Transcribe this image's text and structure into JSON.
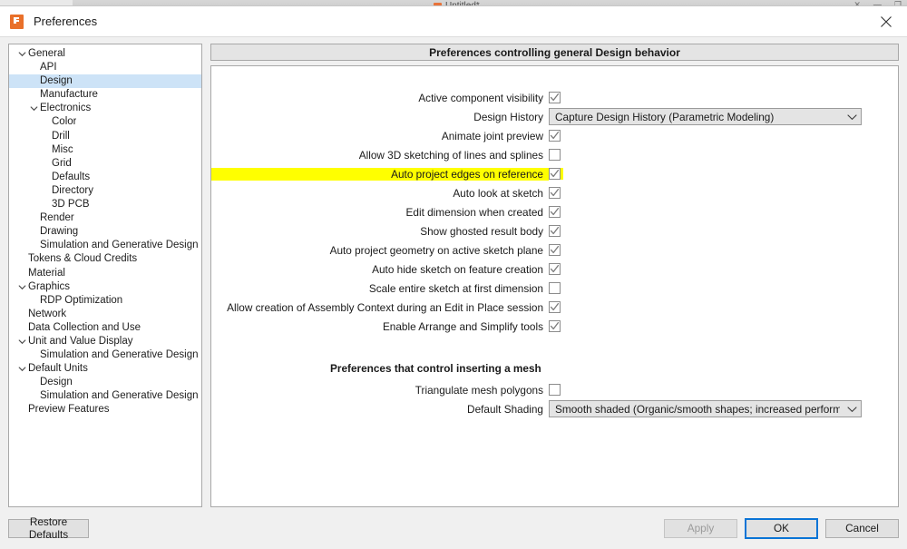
{
  "background_window": {
    "title": "Untitled*",
    "left_hint": "",
    "controls": [
      "✕",
      "▬",
      "❐"
    ]
  },
  "dialog": {
    "title": "Preferences",
    "app_icon": "fusion-logo-icon",
    "close_icon": "close-icon"
  },
  "tree": {
    "items": [
      {
        "label": "General",
        "level": 0,
        "chevron": "down",
        "selected": false
      },
      {
        "label": "API",
        "level": 1,
        "chevron": "",
        "selected": false
      },
      {
        "label": "Design",
        "level": 1,
        "chevron": "",
        "selected": true
      },
      {
        "label": "Manufacture",
        "level": 1,
        "chevron": "",
        "selected": false
      },
      {
        "label": "Electronics",
        "level": 1,
        "chevron": "down",
        "selected": false
      },
      {
        "label": "Color",
        "level": 2,
        "chevron": "",
        "selected": false
      },
      {
        "label": "Drill",
        "level": 2,
        "chevron": "",
        "selected": false
      },
      {
        "label": "Misc",
        "level": 2,
        "chevron": "",
        "selected": false
      },
      {
        "label": "Grid",
        "level": 2,
        "chevron": "",
        "selected": false
      },
      {
        "label": "Defaults",
        "level": 2,
        "chevron": "",
        "selected": false
      },
      {
        "label": "Directory",
        "level": 2,
        "chevron": "",
        "selected": false
      },
      {
        "label": "3D PCB",
        "level": 2,
        "chevron": "",
        "selected": false
      },
      {
        "label": "Render",
        "level": 1,
        "chevron": "",
        "selected": false
      },
      {
        "label": "Drawing",
        "level": 1,
        "chevron": "",
        "selected": false
      },
      {
        "label": "Simulation and Generative Design",
        "level": 1,
        "chevron": "",
        "selected": false
      },
      {
        "label": "Tokens & Cloud Credits",
        "level": 0,
        "chevron": "",
        "selected": false
      },
      {
        "label": "Material",
        "level": 0,
        "chevron": "",
        "selected": false
      },
      {
        "label": "Graphics",
        "level": 0,
        "chevron": "down",
        "selected": false
      },
      {
        "label": "RDP Optimization",
        "level": 1,
        "chevron": "",
        "selected": false
      },
      {
        "label": "Network",
        "level": 0,
        "chevron": "",
        "selected": false
      },
      {
        "label": "Data Collection and Use",
        "level": 0,
        "chevron": "",
        "selected": false
      },
      {
        "label": "Unit and Value Display",
        "level": 0,
        "chevron": "down",
        "selected": false
      },
      {
        "label": "Simulation and Generative Design",
        "level": 1,
        "chevron": "",
        "selected": false
      },
      {
        "label": "Default Units",
        "level": 0,
        "chevron": "down",
        "selected": false
      },
      {
        "label": "Design",
        "level": 1,
        "chevron": "",
        "selected": false
      },
      {
        "label": "Simulation and Generative Design",
        "level": 1,
        "chevron": "",
        "selected": false
      },
      {
        "label": "Preview Features",
        "level": 0,
        "chevron": "",
        "selected": false
      }
    ]
  },
  "panel": {
    "header": "Preferences controlling general Design behavior",
    "rows": [
      {
        "type": "checkbox",
        "label": "Active component visibility",
        "checked": true,
        "highlighted": false
      },
      {
        "type": "combo",
        "label": "Design History",
        "value": "Capture Design History (Parametric Modeling)",
        "highlighted": false
      },
      {
        "type": "checkbox",
        "label": "Animate joint preview",
        "checked": true,
        "highlighted": false
      },
      {
        "type": "checkbox",
        "label": "Allow 3D sketching of lines and splines",
        "checked": false,
        "highlighted": false
      },
      {
        "type": "checkbox",
        "label": "Auto project edges on reference",
        "checked": true,
        "highlighted": true
      },
      {
        "type": "checkbox",
        "label": "Auto look at sketch",
        "checked": true,
        "highlighted": false
      },
      {
        "type": "checkbox",
        "label": "Edit dimension when created",
        "checked": true,
        "highlighted": false
      },
      {
        "type": "checkbox",
        "label": "Show ghosted result body",
        "checked": true,
        "highlighted": false
      },
      {
        "type": "checkbox",
        "label": "Auto project geometry on active sketch plane",
        "checked": true,
        "highlighted": false
      },
      {
        "type": "checkbox",
        "label": "Auto hide sketch on feature creation",
        "checked": true,
        "highlighted": false
      },
      {
        "type": "checkbox",
        "label": "Scale entire sketch at first dimension",
        "checked": false,
        "highlighted": false
      },
      {
        "type": "checkbox",
        "label": "Allow creation of Assembly Context during an Edit in Place session",
        "checked": true,
        "highlighted": false
      },
      {
        "type": "checkbox",
        "label": "Enable Arrange and Simplify tools",
        "checked": true,
        "highlighted": false
      }
    ],
    "mesh_section": {
      "title": "Preferences that control inserting a mesh",
      "rows": [
        {
          "type": "checkbox",
          "label": "Triangulate mesh polygons",
          "checked": false,
          "highlighted": false
        },
        {
          "type": "combo",
          "label": "Default Shading",
          "value": "Smooth shaded (Organic/smooth shapes; increased performance)",
          "highlighted": false
        }
      ]
    }
  },
  "footer": {
    "restore_defaults": "Restore Defaults",
    "apply": "Apply",
    "ok": "OK",
    "cancel": "Cancel"
  },
  "colors": {
    "highlight_yellow": "#FFFF00",
    "tree_selection": "#CDE3F7",
    "focus_blue": "#0A74D6",
    "brand_orange": "#E9702A"
  }
}
